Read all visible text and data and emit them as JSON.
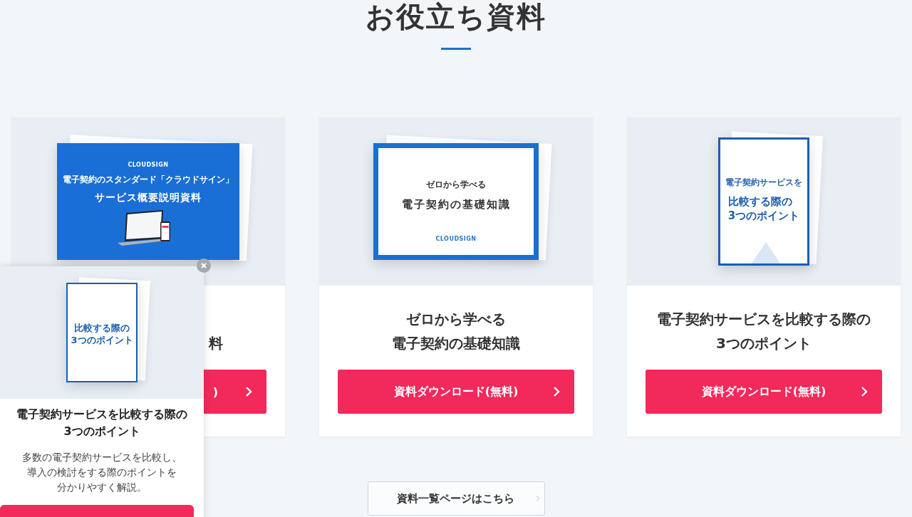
{
  "heading": "お役立ち資料",
  "cards": [
    {
      "clipped": true,
      "cover": {
        "kind": "landscape-blue",
        "logo": "CLOUDSIGN",
        "subtitle": "電子契約のスタンダード「クラウドサイン」",
        "title": [
          "サービス概要説明資料"
        ]
      },
      "title": [
        "料"
      ],
      "button": ")"
    },
    {
      "clipped": false,
      "cover": {
        "kind": "landscape-framed",
        "logo": "CLOUDSIGN",
        "subtitle": "ゼロから学べる",
        "title": [
          "電子契約の基礎知識"
        ]
      },
      "title": [
        "ゼロから学べる",
        "電子契約の基礎知識"
      ],
      "button": "資料ダウンロード(無料)"
    },
    {
      "clipped": false,
      "cover": {
        "kind": "portrait",
        "subtitle": "電子契約サービスを",
        "title": [
          "比較する際の",
          "3つのポイント"
        ]
      },
      "title": [
        "電子契約サービスを比較する際の",
        "3つのポイント"
      ],
      "button": "資料ダウンロード(無料)"
    }
  ],
  "more_button": "資料一覧ページはこちら",
  "popup": {
    "cover": {
      "kind": "portrait-small",
      "title": [
        "比較する際の",
        "3つのポイント"
      ]
    },
    "title": [
      "電子契約サービスを比較する際の",
      "3つのポイント"
    ],
    "description": [
      "多数の電子契約サービスを比較し、",
      "導入の検討をする際のポイントを",
      "分かりやすく解説。"
    ]
  }
}
